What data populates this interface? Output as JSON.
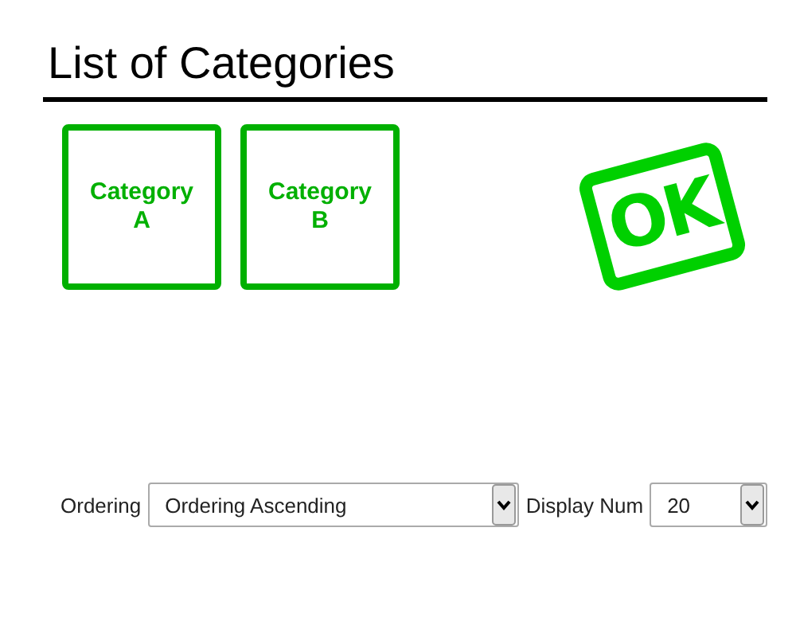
{
  "title": "List of Categories",
  "categories": [
    {
      "label": "Category A"
    },
    {
      "label": "Category B"
    }
  ],
  "stamp": {
    "text": "OK"
  },
  "controls": [
    {
      "label": "Ordering",
      "value": "Ordering Ascending"
    },
    {
      "label": "Display Num",
      "value": "20"
    }
  ]
}
